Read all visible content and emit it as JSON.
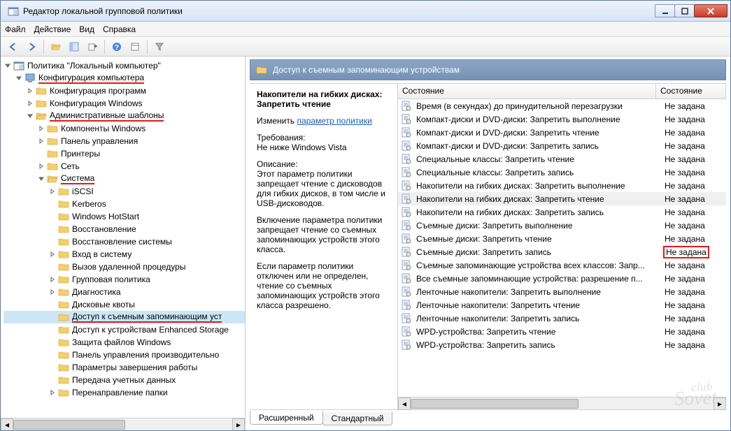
{
  "window": {
    "title": "Редактор локальной групповой политики"
  },
  "menu": {
    "file": "Файл",
    "action": "Действие",
    "view": "Вид",
    "help": "Справка"
  },
  "tree": {
    "root": "Политика \"Локальный компьютер\"",
    "comp_config": "Конфигурация компьютера",
    "prog_config": "Конфигурация программ",
    "win_config": "Конфигурация Windows",
    "admin_templates": "Административные шаблоны",
    "win_components": "Компоненты Windows",
    "control_panel": "Панель управления",
    "printers": "Принтеры",
    "network": "Сеть",
    "system": "Система",
    "iscsi": "iSCSI",
    "kerberos": "Kerberos",
    "hotstart": "Windows HotStart",
    "recovery": "Восстановление",
    "sysrestore": "Восстановление системы",
    "logon": "Вход в систему",
    "rpc": "Вызов удаленной процедуры",
    "gp": "Групповая политика",
    "diagnostics": "Диагностика",
    "diskquota": "Дисковые квоты",
    "removable": "Доступ к съемным запоминающим уст",
    "enhanced": "Доступ к устройствам Enhanced Storage",
    "wfp": "Защита файлов Windows",
    "perfpanel": "Панель управления производительно",
    "shutdownparams": "Параметры завершения работы",
    "credtransfer": "Передача учетных данных",
    "folderredir": "Перенаправление папки"
  },
  "header": {
    "title": "Доступ к съемным запоминающим устройствам"
  },
  "desc": {
    "title": "Накопители на гибких дисках: Запретить чтение",
    "edit_label": "Изменить",
    "edit_link": "параметр политики",
    "req_label": "Требования:",
    "req_value": "Не ниже Windows Vista",
    "desc_label": "Описание:",
    "desc_p1": "Этот параметр политики запрещает чтение с дисководов для гибких дисков, в том числе и USB-дисководов.",
    "desc_p2": "Включение параметра политики запрещает чтение со съемных запоминающих устройств этого класса.",
    "desc_p3": "Если параметр политики отключен или не определен, чтение со съемных запоминающих устройств этого класса разрешено."
  },
  "columns": {
    "state1": "Состояние",
    "state2": "Состояние"
  },
  "rows": [
    {
      "name": "Время (в секундах) до принудительной перезагрузки",
      "state": "Не задана"
    },
    {
      "name": "Компакт-диски и DVD-диски: Запретить выполнение",
      "state": "Не задана"
    },
    {
      "name": "Компакт-диски и DVD-диски: Запретить чтение",
      "state": "Не задана"
    },
    {
      "name": "Компакт-диски и DVD-диски: Запретить запись",
      "state": "Не задана"
    },
    {
      "name": "Специальные классы: Запретить чтение",
      "state": "Не задана"
    },
    {
      "name": "Специальные классы: Запретить запись",
      "state": "Не задана"
    },
    {
      "name": "Накопители на гибких дисках: Запретить выполнение",
      "state": "Не задана"
    },
    {
      "name": "Накопители на гибких дисках: Запретить чтение",
      "state": "Не задана",
      "selected": true
    },
    {
      "name": "Накопители на гибких дисках: Запретить запись",
      "state": "Не задана"
    },
    {
      "name": "Съемные диски: Запретить выполнение",
      "state": "Не задана"
    },
    {
      "name": "Съемные диски: Запретить чтение",
      "state": "Не задана"
    },
    {
      "name": "Съемные диски: Запретить запись",
      "state": "Не задана",
      "highlight": true
    },
    {
      "name": "Съемные запоминающие устройства всех классов: Запр...",
      "state": "Не задана"
    },
    {
      "name": "Все съемные запоминающие устройства: разрешение п...",
      "state": "Не задана"
    },
    {
      "name": "Ленточные накопители: Запретить выполнение",
      "state": "Не задана"
    },
    {
      "name": "Ленточные накопители: Запретить чтение",
      "state": "Не задана"
    },
    {
      "name": "Ленточные накопители: Запретить запись",
      "state": "Не задана"
    },
    {
      "name": "WPD-устройства: Запретить чтение",
      "state": "Не задана"
    },
    {
      "name": "WPD-устройства: Запретить запись",
      "state": "Не задана"
    }
  ],
  "tabs": {
    "extended": "Расширенный",
    "standard": "Стандартный"
  }
}
